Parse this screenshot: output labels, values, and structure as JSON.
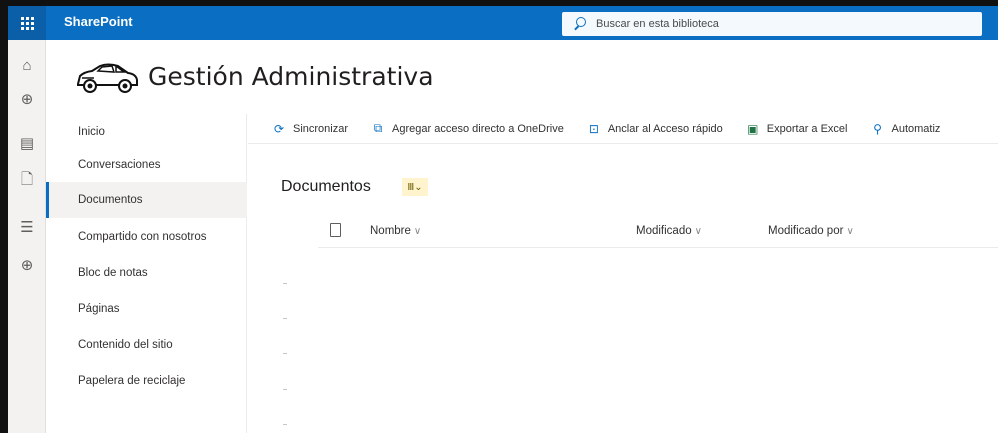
{
  "suitebar": {
    "brand": "SharePoint",
    "search_placeholder": "Buscar en esta biblioteca",
    "accent": "#0a6fc2"
  },
  "app_rail": {
    "items": [
      {
        "icon": "home-icon",
        "glyph": "⌂"
      },
      {
        "icon": "globe-icon",
        "glyph": "⊕"
      },
      {
        "icon": "news-icon",
        "glyph": "▤"
      },
      {
        "icon": "file-icon",
        "glyph": "🗋"
      },
      {
        "icon": "lists-icon",
        "glyph": "☰"
      },
      {
        "icon": "create-icon",
        "glyph": "⊕"
      }
    ]
  },
  "site": {
    "title": "Gestión Administrativa",
    "logo_icon": "car-icon"
  },
  "left_nav": {
    "items": [
      {
        "label": "Inicio"
      },
      {
        "label": "Conversaciones"
      },
      {
        "label": "Documentos",
        "selected": true
      },
      {
        "label": "Compartido con nosotros"
      },
      {
        "label": "Bloc de notas"
      },
      {
        "label": "Páginas"
      },
      {
        "label": "Contenido del sitio"
      },
      {
        "label": "Papelera de reciclaje"
      }
    ]
  },
  "command_bar": {
    "items": [
      {
        "label": "Sincronizar",
        "icon": "sync-icon"
      },
      {
        "label": "Agregar acceso directo a OneDrive",
        "icon": "shortcut-icon"
      },
      {
        "label": "Anclar al Acceso rápido",
        "icon": "pin-icon"
      },
      {
        "label": "Exportar a Excel",
        "icon": "excel-icon"
      },
      {
        "label": "Automatiz",
        "icon": "automate-icon"
      }
    ]
  },
  "library": {
    "title": "Documentos",
    "view_icon": "library-view-icon",
    "columns": [
      {
        "label": "Nombre"
      },
      {
        "label": "Modificado"
      },
      {
        "label": "Modificado por"
      }
    ]
  }
}
